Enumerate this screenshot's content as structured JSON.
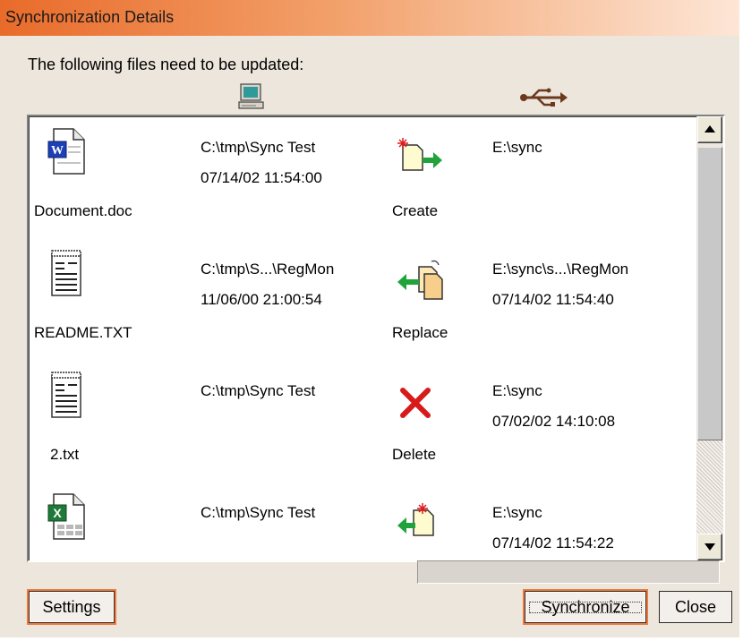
{
  "window": {
    "title": "Synchronization Details"
  },
  "prompt": "The following files need to be updated:",
  "column_icons": {
    "source": "computer-icon",
    "destination": "usb-icon"
  },
  "rows": [
    {
      "filename": "Document.doc",
      "file_icon": "word-document-icon",
      "source_path": "C:\\tmp\\Sync Test",
      "source_time": "07/14/02 11:54:00",
      "action": "Create",
      "action_icon": "create-arrow-right-icon",
      "dest_path": "E:\\sync",
      "dest_time": ""
    },
    {
      "filename": "README.TXT",
      "file_icon": "text-file-icon",
      "source_path": "C:\\tmp\\S...\\RegMon",
      "source_time": "11/06/00 21:00:54",
      "action": "Replace",
      "action_icon": "replace-arrow-left-icon",
      "dest_path": "E:\\sync\\s...\\RegMon",
      "dest_time": "07/14/02 11:54:40"
    },
    {
      "filename": "2.txt",
      "file_icon": "text-file-icon",
      "source_path": "C:\\tmp\\Sync Test",
      "source_time": "",
      "action": "Delete",
      "action_icon": "delete-x-icon",
      "dest_path": "E:\\sync",
      "dest_time": "07/02/02 14:10:08"
    },
    {
      "filename": "",
      "file_icon": "excel-spreadsheet-icon",
      "source_path": "C:\\tmp\\Sync Test",
      "source_time": "",
      "action": "",
      "action_icon": "create-arrow-left-icon",
      "dest_path": "E:\\sync",
      "dest_time": "07/14/02 11:54:22"
    }
  ],
  "buttons": {
    "settings": "Settings",
    "synchronize": "Synchronize",
    "close": "Close"
  },
  "colors": {
    "title_gradient_start": "#e96b2a",
    "title_gradient_end": "#fde6d6",
    "dialog_bg": "#ede6dd",
    "focus_border": "#f07a3c",
    "arrow_green": "#1fa33a",
    "delete_red": "#d81a1a"
  }
}
